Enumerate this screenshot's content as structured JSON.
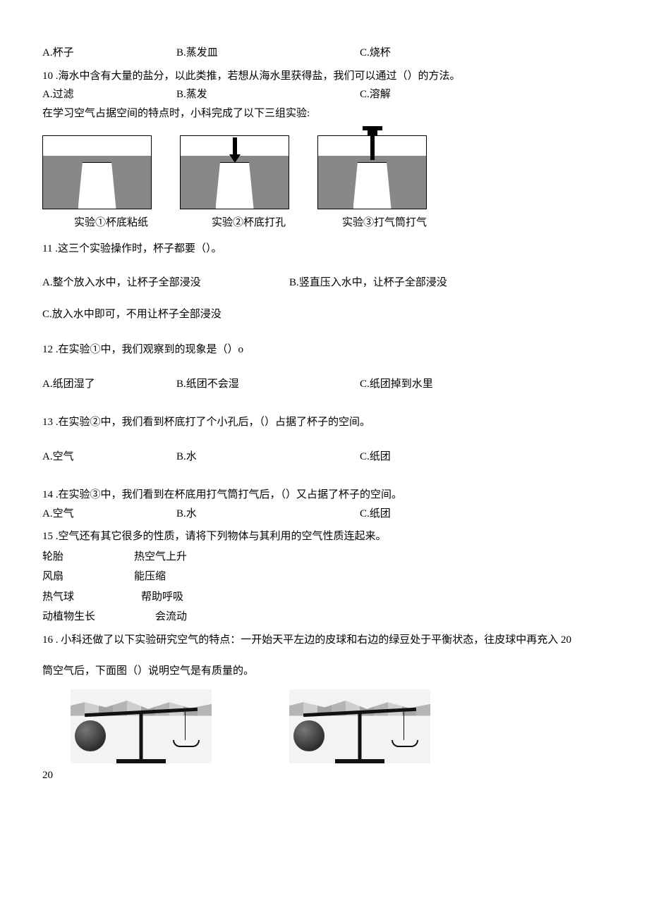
{
  "q9": {
    "a": "A.杯子",
    "b": "B.蒸发皿",
    "c": "C.烧杯"
  },
  "q10": {
    "stem": "10 .海水中含有大量的盐分，以此类推，若想从海水里获得盐，我们可以通过（）的方法。",
    "a": "A.过滤",
    "b": "B.蒸发",
    "c": "C.溶解"
  },
  "intro": "在学习空气占据空间的特点时，小科完成了以下三组实验:",
  "diagram_labels": {
    "one": "实验①杯底粘纸",
    "two": "实验②杯底打孔",
    "three": "实验③打气筒打气"
  },
  "q11": {
    "stem": "11 .这三个实验操作时，杯子都要（）。",
    "a": "A.整个放入水中，让杯子全部浸没",
    "b": "B.竖直压入水中，让杯子全部浸没",
    "c": "C.放入水中即可，不用让杯子全部浸没"
  },
  "q12": {
    "stem": "12 .在实验①中，我们观察到的现象是（）o",
    "a": "A.纸团湿了",
    "b": "B.纸团不会湿",
    "c": "C.纸团掉到水里"
  },
  "q13": {
    "stem": "13 .在实验②中，我们看到杯底打了个小孔后，（）占据了杯子的空间。",
    "a": "A.空气",
    "b": "B.水",
    "c": "C.纸团"
  },
  "q14": {
    "stem": "14 .在实验③中，我们看到在杯底用打气筒打气后，（）又占据了杯子的空间。",
    "a": "A.空气",
    "b": "B.水",
    "c": "C.纸团"
  },
  "q15": {
    "stem": "15 .空气还有其它很多的性质，请将下列物体与其利用的空气性质连起来。",
    "matches": {
      "m1_left": "轮胎",
      "m1_right": "热空气上升",
      "m2_left": "风扇",
      "m2_right": "能压缩",
      "m3_left": "热气球",
      "m3_right": "帮助呼吸",
      "m4_left": "动植物生长",
      "m4_right": "会流动"
    }
  },
  "q16": {
    "stem": "16 . 小科还做了以下实验研究空气的特点：一开始天平左边的皮球和右边的绿豆处于平衡状态，往皮球中再充入 20",
    "stem2": "筒空气后，下面图（）说明空气是有质量的。"
  },
  "footer": "20"
}
